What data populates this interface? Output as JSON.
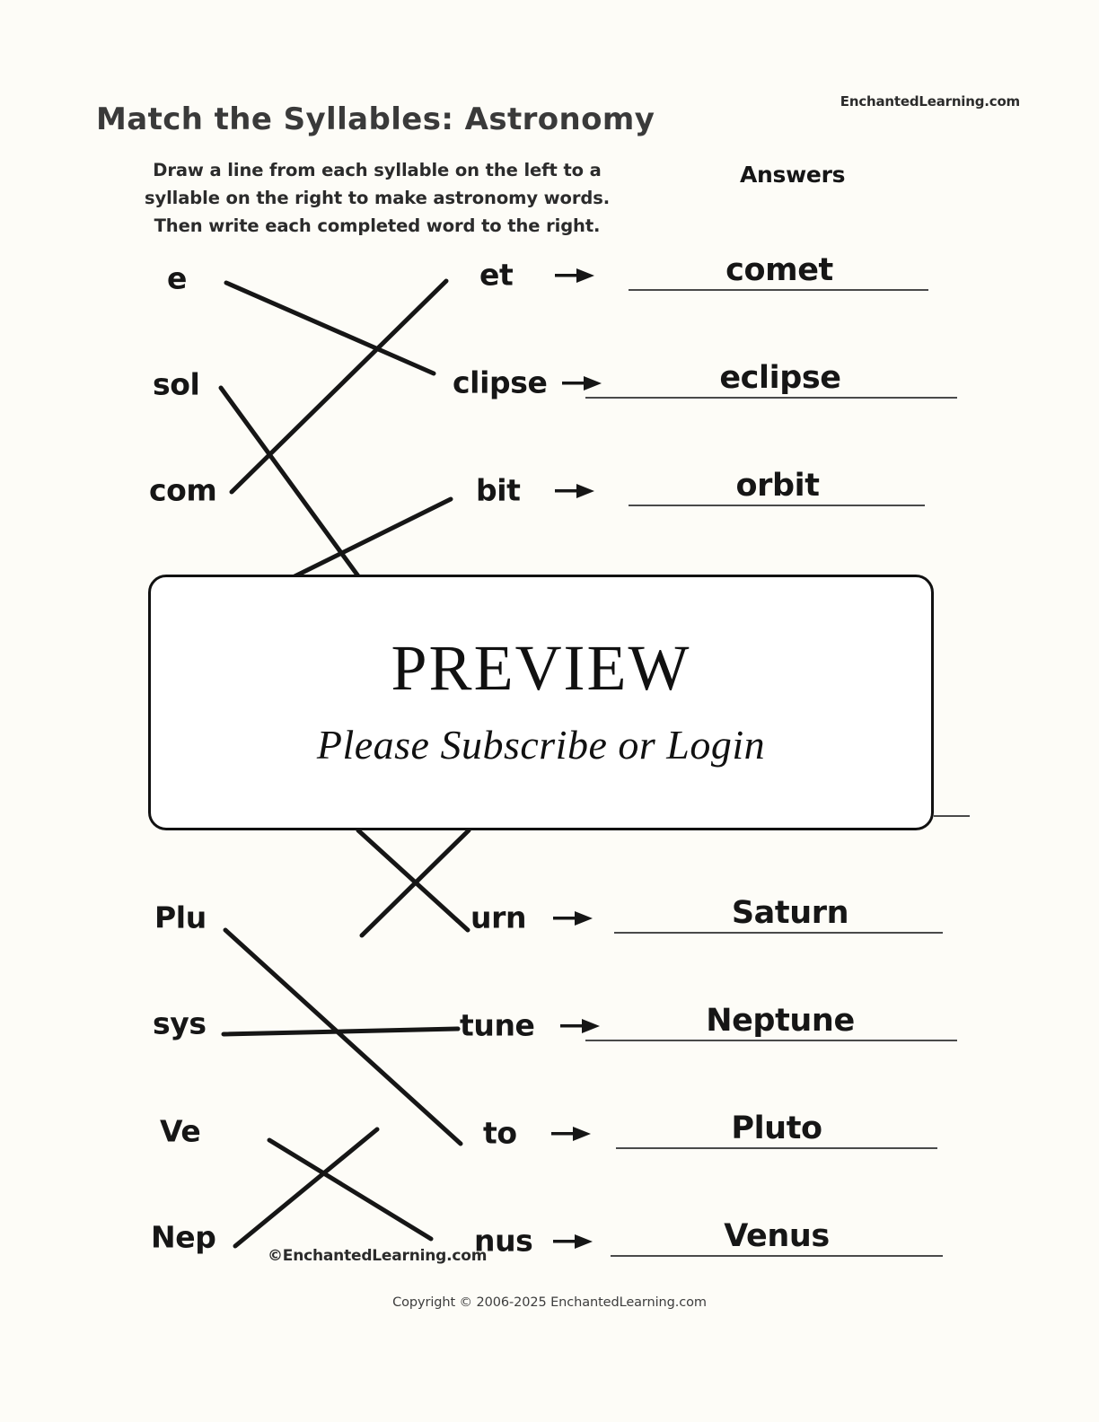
{
  "header": {
    "brand": "EnchantedLearning.com",
    "title": "Match the Syllables: Astronomy",
    "instructions": [
      "Draw a line from each syllable on the left to a",
      "syllable on the right to make astronomy words.",
      "Then write each completed word to the right."
    ],
    "answers_heading": "Answers"
  },
  "rows": [
    {
      "left": "e",
      "right": "et",
      "answer": "comet"
    },
    {
      "left": "sol",
      "right": "clipse",
      "answer": "eclipse"
    },
    {
      "left": "com",
      "right": "bit",
      "answer": "orbit"
    },
    {
      "left": "Plu",
      "right": "urn",
      "answer": "Saturn"
    },
    {
      "left": "sys",
      "right": "tune",
      "answer": "Neptune"
    },
    {
      "left": "Ve",
      "right": "to",
      "answer": "Pluto"
    },
    {
      "left": "Nep",
      "right": "nus",
      "answer": "Venus"
    }
  ],
  "preview": {
    "title": "PREVIEW",
    "subtitle": "Please Subscribe or Login"
  },
  "footer": {
    "watermark": "©EnchantedLearning.com",
    "copyright": "Copyright © 2006-2025 EnchantedLearning.com"
  },
  "colors": {
    "page_background": "#fdfcf7",
    "ink": "#161616",
    "title_ink": "#3a3a3a",
    "rule": "#4a4a4a",
    "box_border": "#111111",
    "box_fill": "#ffffff"
  }
}
